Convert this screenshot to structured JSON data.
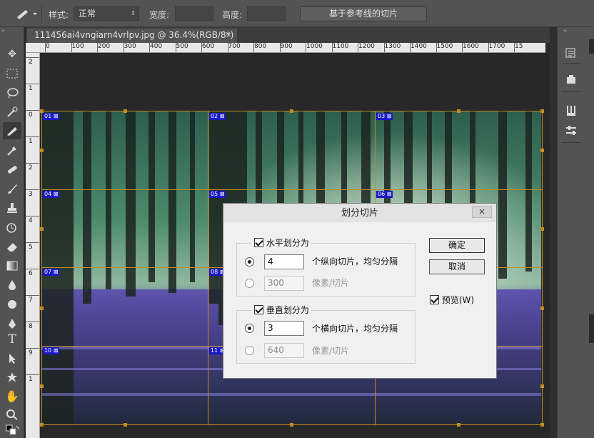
{
  "options_bar": {
    "style_label": "样式:",
    "style_value": "正常",
    "width_label": "宽度:",
    "height_label": "高度:",
    "slice_from_guides_button": "基于参考线的切片"
  },
  "document": {
    "tab_title": "111456ai4vngiarn4vrlpv.jpg @ 36.4%(RGB/8*) *",
    "close_glyph": "×"
  },
  "rulers": {
    "horizontal": [
      "0",
      "100",
      "200",
      "300",
      "400",
      "500",
      "600",
      "700",
      "800",
      "900",
      "1000",
      "1100",
      "1200",
      "1300",
      "1400",
      "1500",
      "1600",
      "1700",
      "15"
    ],
    "vertical": [
      "2",
      "1",
      "0",
      "1",
      "2",
      "3",
      "4",
      "5",
      "6",
      "7",
      "8",
      "9",
      "1"
    ]
  },
  "slices": [
    "01",
    "02",
    "03",
    "04",
    "05",
    "06",
    "07",
    "08",
    "10",
    "11"
  ],
  "dialog": {
    "title": "划分切片",
    "close_glyph": "×",
    "horizontal_group_label": "水平划分为",
    "horizontal_count_value": "4",
    "horizontal_count_suffix": "个纵向切片，均匀分隔",
    "horizontal_pixels_value": "300",
    "horizontal_pixels_suffix": "像素/切片",
    "vertical_group_label": "垂直划分为",
    "vertical_count_value": "3",
    "vertical_count_suffix": "个横向切片，均匀分隔",
    "vertical_pixels_value": "640",
    "vertical_pixels_suffix": "像素/切片",
    "ok_button": "确定",
    "cancel_button": "取消",
    "preview_label": "预览(W)"
  },
  "colors": {
    "guide": "#c28c23",
    "slice_label_bg": "#1818c8",
    "ui_panel": "#535353",
    "dialog_bg": "#f0f0f0"
  },
  "icons": {
    "tools": [
      "move-icon",
      "marquee-icon",
      "lasso-icon",
      "quick-select-icon",
      "slice-icon",
      "eyedropper-icon",
      "healing-icon",
      "brush-icon",
      "stamp-icon",
      "history-brush-icon",
      "eraser-icon",
      "gradient-icon",
      "blur-icon",
      "dodge-icon",
      "pen-icon",
      "type-icon",
      "path-select-icon",
      "shape-icon",
      "hand-icon",
      "zoom-icon"
    ],
    "right_panel": [
      "history-icon",
      "properties-icon",
      "brushes-icon",
      "adjustments-icon"
    ]
  }
}
